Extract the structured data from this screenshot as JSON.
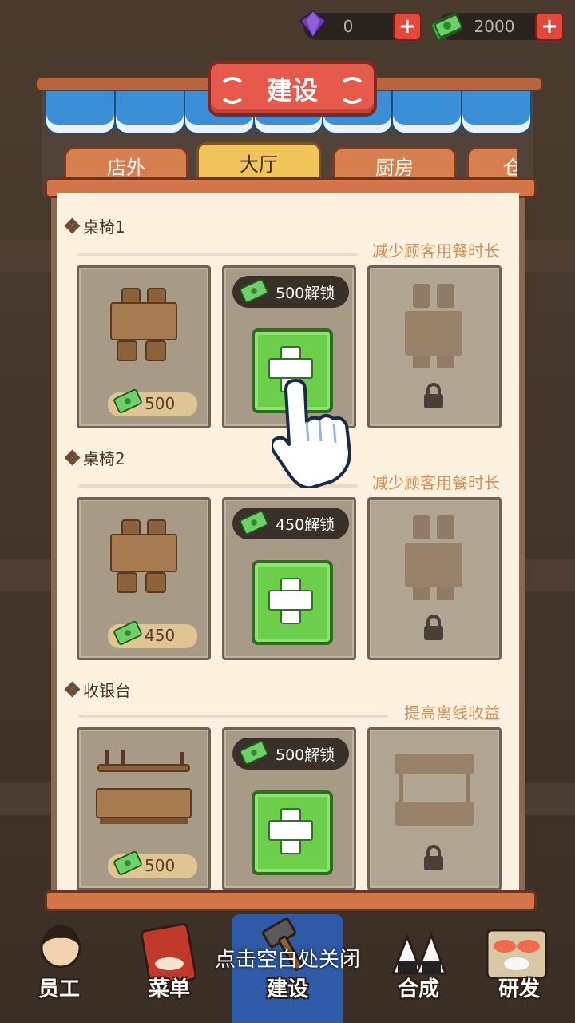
{
  "currency": {
    "gems": "0",
    "cash": "2000"
  },
  "header": {
    "title": "建设"
  },
  "tabs": [
    {
      "label": "店外",
      "active": false
    },
    {
      "label": "大厅",
      "active": true
    },
    {
      "label": "厨房",
      "active": false
    },
    {
      "label": "仓",
      "active": false
    }
  ],
  "sections": [
    {
      "title": "桌椅1",
      "desc": "减少顾客用餐时长",
      "owned_price": "500",
      "unlock_label": "500解锁"
    },
    {
      "title": "桌椅2",
      "desc": "减少顾客用餐时长",
      "owned_price": "450",
      "unlock_label": "450解锁"
    },
    {
      "title": "收银台",
      "desc": "提高离线收益",
      "owned_price": "500",
      "unlock_label": "500解锁"
    }
  ],
  "close_hint": "点击空白处关闭",
  "nav": [
    {
      "label": "员工",
      "active": false
    },
    {
      "label": "菜单",
      "active": false
    },
    {
      "label": "建设",
      "active": true
    },
    {
      "label": "合成",
      "active": false
    },
    {
      "label": "研发",
      "active": false
    }
  ],
  "colors": {
    "accent_red": "#e55a4c",
    "awning_blue": "#3b8fd6",
    "plus_green": "#6ccf4c",
    "paper": "#fbf1de",
    "desc_orange": "#d3925a"
  }
}
